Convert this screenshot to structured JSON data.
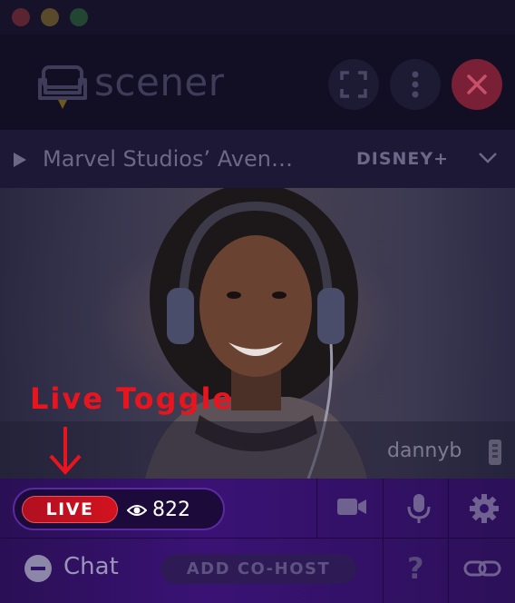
{
  "window": {
    "title": ""
  },
  "header": {
    "app_name": "scener",
    "buttons": [
      {
        "name": "expand-button",
        "icon": "fullscreen-icon"
      },
      {
        "name": "more-button",
        "icon": "kebab-icon"
      },
      {
        "name": "close-button",
        "icon": "close-icon"
      }
    ]
  },
  "now_playing": {
    "title": "Marvel Studios’ Aven…",
    "provider": "DISNEY+"
  },
  "video": {
    "username": "dannyb"
  },
  "annotation": {
    "label": "Live Toggle"
  },
  "controls": {
    "live_label": "LIVE",
    "viewer_count": "822",
    "chat_label": "Chat",
    "add_cohost_label": "ADD CO-HOST",
    "help_label": "?"
  },
  "colors": {
    "accent_live": "#d3121f",
    "annotation": "#e8151f",
    "control_bar": "#3a1275",
    "close_button": "#7a2036"
  }
}
